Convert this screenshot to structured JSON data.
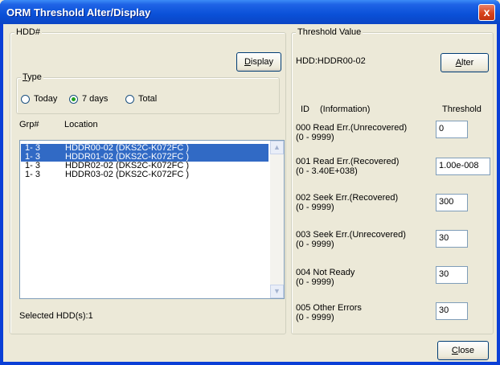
{
  "window": {
    "title": "ORM Threshold Alter/Display",
    "close_glyph": "x"
  },
  "hdd_group": {
    "legend": "HDD#",
    "display_button": {
      "accel": "D",
      "rest": "isplay"
    },
    "type_group": {
      "legend_accel": "T",
      "legend_rest": "ype",
      "options": [
        {
          "label": "Today",
          "selected": false
        },
        {
          "label": "7 days",
          "selected": true
        },
        {
          "label": "Total",
          "selected": false
        }
      ]
    },
    "columns": {
      "grp": "Grp#",
      "location": "Location"
    },
    "rows": [
      {
        "grp": "1- 3",
        "location": "HDDR00-02 (DKS2C-K072FC     )",
        "selected": true
      },
      {
        "grp": "1- 3",
        "location": "HDDR01-02 (DKS2C-K072FC     )",
        "selected": true
      },
      {
        "grp": "1- 3",
        "location": "HDDR02-02 (DKS2C-K072FC     )",
        "selected": false
      },
      {
        "grp": "1- 3",
        "location": "HDDR03-02 (DKS2C-K072FC     )",
        "selected": false
      }
    ],
    "selected_text": "Selected HDD(s):1"
  },
  "threshold_group": {
    "legend": "Threshold Value",
    "hdd_label": "HDD:HDDR00-02",
    "alter_button": {
      "accel": "A",
      "rest": "lter"
    },
    "col_id": "ID",
    "col_info": "(Information)",
    "col_threshold": "Threshold",
    "items": [
      {
        "name": "000  Read Err.(Unrecovered)",
        "range": "(0 - 9999)",
        "value": "0"
      },
      {
        "name": "001  Read Err.(Recovered)",
        "range": "(0 - 3.40E+038)",
        "value": "1.00e-008"
      },
      {
        "name": "002  Seek Err.(Recovered)",
        "range": "(0 - 9999)",
        "value": "300"
      },
      {
        "name": "003  Seek Err.(Unrecovered)",
        "range": "(0 - 9999)",
        "value": "30"
      },
      {
        "name": "004  Not Ready",
        "range": "(0 - 9999)",
        "value": "30"
      },
      {
        "name": "005  Other Errors",
        "range": "(0 - 9999)",
        "value": "30"
      }
    ]
  },
  "close_button": {
    "accel": "C",
    "rest": "lose"
  },
  "colors": {
    "selection": "#316ac5",
    "titlebar": "#0a50d8",
    "face": "#ece9d8"
  }
}
